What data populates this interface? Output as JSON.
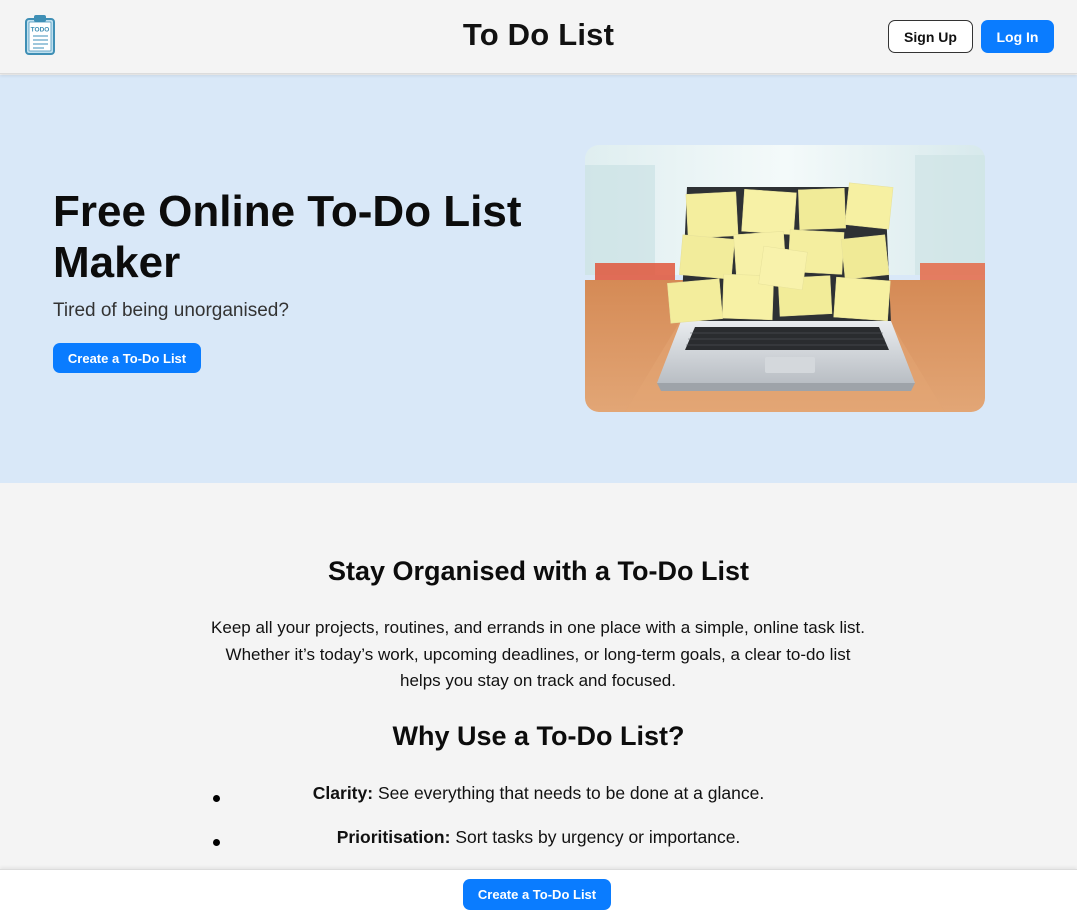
{
  "header": {
    "logo_icon": "clipboard-todo-icon",
    "logo_text": "TODO",
    "title": "To Do List",
    "signup_label": "Sign Up",
    "login_label": "Log In"
  },
  "hero": {
    "title": "Free Online To-Do List Maker",
    "subtitle": "Tired of being unorganised?",
    "cta_label": "Create a To-Do List",
    "image_icon": "laptop-sticky-notes-photo"
  },
  "main": {
    "section1_title": "Stay Organised with a To-Do List",
    "section1_text": "Keep all your projects, routines, and errands in one place with a simple, online task list. Whether it’s today’s work, upcoming deadlines, or long-term goals, a clear to-do list helps you stay on track and focused.",
    "section2_title": "Why Use a To-Do List?",
    "reasons": [
      {
        "term": "Clarity:",
        "text": " See everything that needs to be done at a glance."
      },
      {
        "term": "Prioritisation:",
        "text": " Sort tasks by urgency or importance."
      }
    ]
  },
  "footer": {
    "cta_label": "Create a To-Do List"
  },
  "colors": {
    "accent": "#0a7cff",
    "hero_bg": "#d9e8f8",
    "page_bg": "#f4f4f4"
  }
}
